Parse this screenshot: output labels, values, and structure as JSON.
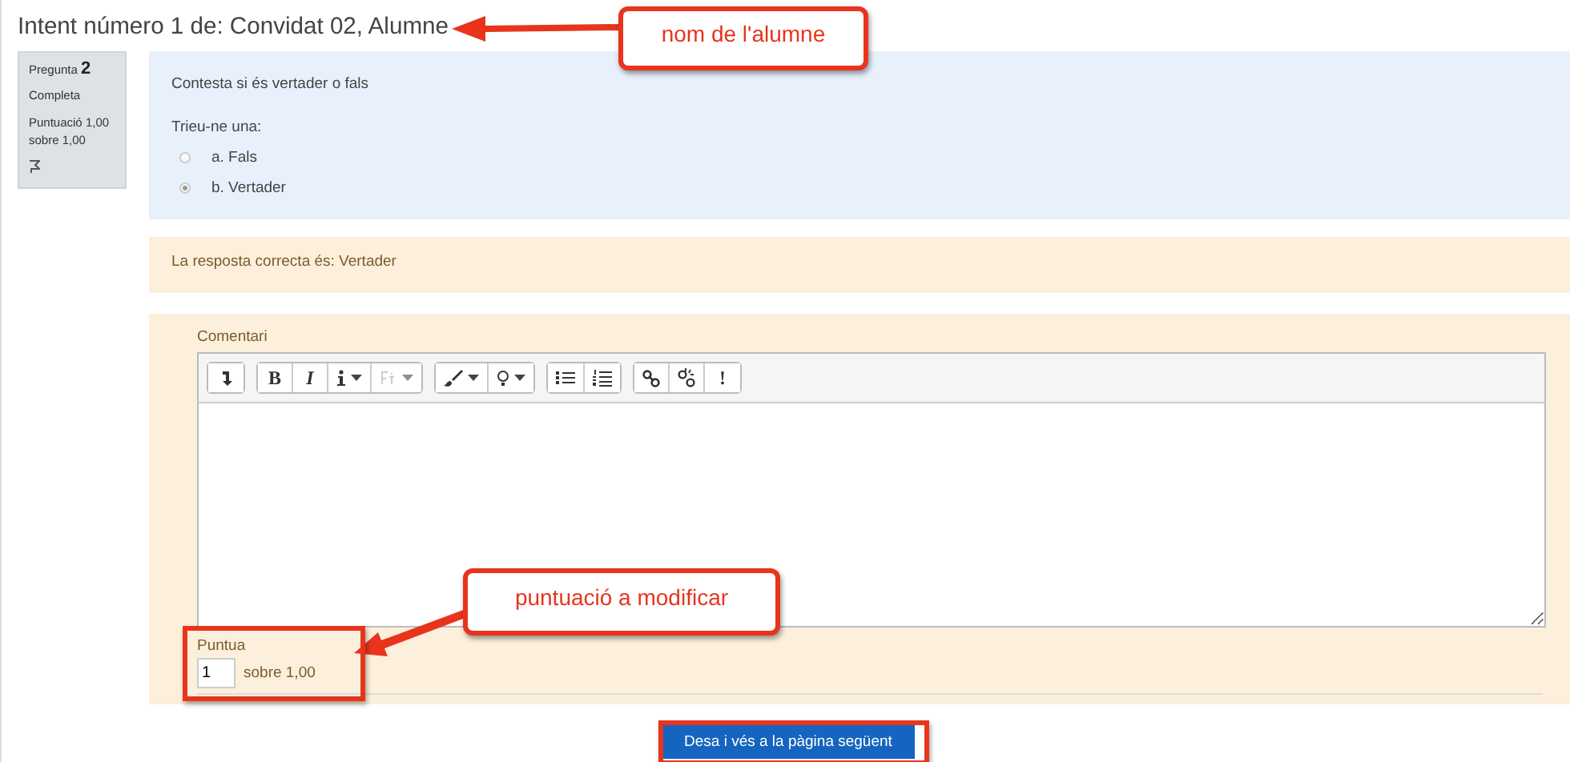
{
  "title": "Intent número 1 de: Convidat 02, Alumne",
  "question_info": {
    "label": "Pregunta",
    "number": "2",
    "state": "Completa",
    "grade": "Puntuació 1,00 sobre 1,00",
    "flagged": false
  },
  "question": {
    "text": "Contesta si és vertader o fals",
    "prompt": "Trieu-ne una:",
    "options": [
      {
        "label": "a. Fals",
        "selected": false
      },
      {
        "label": "b. Vertader",
        "selected": true
      }
    ]
  },
  "outcome": "La resposta correcta és: Vertader",
  "comment": {
    "label": "Comentari",
    "toolbar": [
      [
        {
          "kind": "icon",
          "dropdown": false
        }
      ],
      [
        {
          "kind": "text",
          "label": "B",
          "dropdown": false
        },
        {
          "kind": "text",
          "label": "I",
          "dropdown": false
        },
        {
          "kind": "icon",
          "dropdown": true
        },
        {
          "kind": "icon",
          "dropdown": true,
          "disabled": true
        }
      ],
      [
        {
          "kind": "icon",
          "dropdown": true
        },
        {
          "kind": "icon",
          "dropdown": true
        }
      ],
      [
        {
          "kind": "icon",
          "dropdown": false
        },
        {
          "kind": "icon",
          "dropdown": false
        }
      ],
      [
        {
          "kind": "icon",
          "dropdown": false
        },
        {
          "kind": "icon",
          "dropdown": false
        },
        {
          "kind": "text",
          "label": "!",
          "dropdown": false
        }
      ]
    ]
  },
  "grade": {
    "label": "Puntua",
    "value": "1",
    "max": "sobre 1,00"
  },
  "submit": "Desa i vés a la pàgina següent",
  "annotations": [
    {
      "kind": "callout",
      "text": "nom de l'alumne"
    },
    {
      "kind": "callout",
      "text": "puntuació a modificar"
    },
    {
      "kind": "highlight"
    },
    {
      "kind": "highlight"
    }
  ]
}
